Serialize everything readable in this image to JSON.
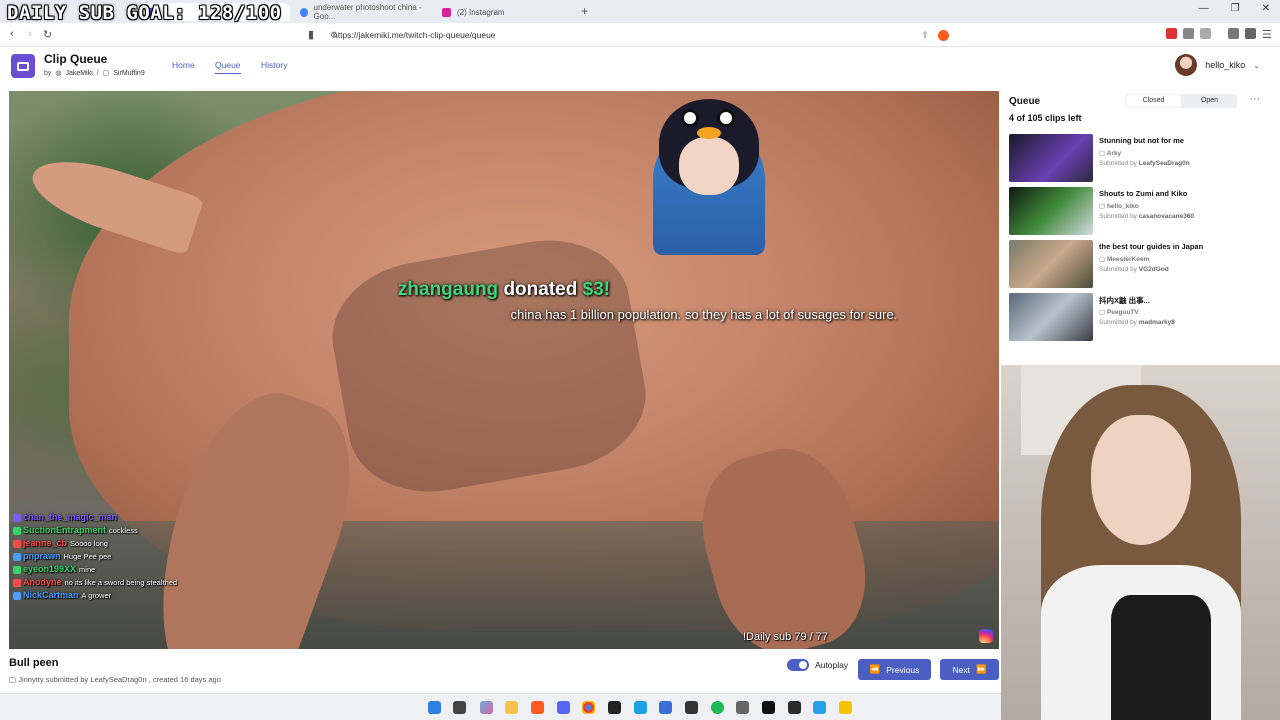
{
  "overlay": {
    "sub_goal": "DAILY SUB GOAL: 128/100"
  },
  "browser": {
    "tabs": [
      {
        "title": "underwater photoshoot china - Goo..."
      },
      {
        "title": "(2) Instagram"
      }
    ],
    "url": "https://jakemiki.me/twitch-clip-queue/queue"
  },
  "app": {
    "title": "Clip Queue",
    "by_label": "by",
    "author1": "JakeMiki",
    "author2": "SirMuffin9",
    "nav": [
      {
        "label": "Home"
      },
      {
        "label": "Queue"
      },
      {
        "label": "History"
      }
    ],
    "user": "hello_kiko"
  },
  "video": {
    "donation_name": "zhangaung",
    "donation_word": "donated",
    "donation_amount": "$3!",
    "donation_message": "china has 1 billion population. so they has a lot of susages for sure.",
    "daily_sub": "!Daily sub 79 / 77",
    "chat": [
      {
        "user": "chan_the_magic_man",
        "msg": "",
        "color": "#7b5cff"
      },
      {
        "user": "SuctionEntrapment",
        "msg": "cockless",
        "color": "#38d46a"
      },
      {
        "user": "jeanne_cb",
        "msg": "Soooo long",
        "color": "#ff4b4b"
      },
      {
        "user": "pnprawn",
        "msg": "Huge Pee pee",
        "color": "#4b9dff"
      },
      {
        "user": "eyeon199XX",
        "msg": "mine",
        "color": "#38d46a"
      },
      {
        "user": "Anodyne",
        "msg": "no its like a sword being stealthed",
        "color": "#ff4b4b"
      },
      {
        "user": "NickCartman",
        "msg": "A grower",
        "color": "#4b9dff"
      }
    ]
  },
  "clip": {
    "title": "Bull peen",
    "channel": "Jinnytty",
    "submitted_by_label": "submitted by",
    "submitter": "LeafySeaDrag0n",
    "created": "created 16 days ago"
  },
  "controls": {
    "autoplay_label": "Autoplay",
    "previous_label": "Previous",
    "next_label": "Next"
  },
  "queue": {
    "heading": "Queue",
    "count": "4 of 105 clips left",
    "closed_label": "Closed",
    "open_label": "Open",
    "items": [
      {
        "title": "Stunning but not for me",
        "channel": "Arky",
        "submitted": "Submitted by",
        "submitter": "LeafySeaDrag0n"
      },
      {
        "title": "Shouts to Zumi and Kiko",
        "channel": "hello_kiko",
        "submitted": "Submitted by",
        "submitter": "casanovacane360"
      },
      {
        "title": "the best tour guides in Japan",
        "channel": "MeesterKeem",
        "submitted": "Submitted by",
        "submitter": "VG2dGod"
      },
      {
        "title": "抖内X鼬 出事...",
        "channel": "PeeguuTV",
        "submitted": "Submitted by",
        "submitter": "madmarky8"
      }
    ]
  },
  "colors": {
    "accent": "#4a5fc1",
    "logo": "#6a4fd3",
    "donation_green": "#3fd57a"
  }
}
